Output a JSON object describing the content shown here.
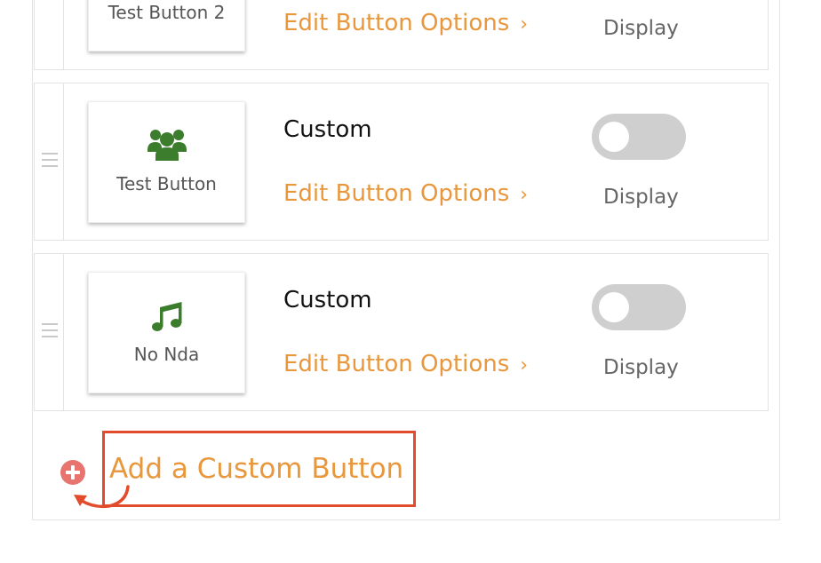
{
  "rows": [
    {
      "preview_label": "Test Button 2",
      "type": "",
      "edit_label": "Edit Button Options",
      "display_label": "Display",
      "toggle_on": false
    },
    {
      "preview_label": "Test Button",
      "preview_icon": "users-icon",
      "type": "Custom",
      "edit_label": "Edit Button Options",
      "display_label": "Display",
      "toggle_on": false
    },
    {
      "preview_label": "No Nda",
      "preview_icon": "music-note-icon",
      "type": "Custom",
      "edit_label": "Edit Button Options",
      "display_label": "Display",
      "toggle_on": false
    }
  ],
  "add_button": {
    "label": "Add a Custom Button",
    "icon": "plus-circle-icon"
  },
  "colors": {
    "accent_orange": "#e8973c",
    "icon_green": "#3b7d2c",
    "add_icon_red": "#e87470",
    "highlight_red": "#e24b2b",
    "toggle_off": "#cfcfcf"
  }
}
